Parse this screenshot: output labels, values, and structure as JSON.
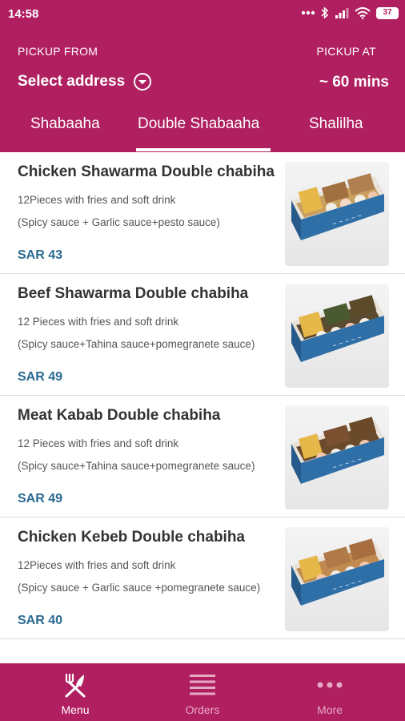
{
  "status_bar": {
    "time": "14:58",
    "battery_level": "37"
  },
  "header": {
    "pickup_from_label": "PICKUP FROM",
    "select_address": "Select address",
    "pickup_at_label": "PICKUP AT",
    "pickup_time": "~ 60 mins"
  },
  "tabs": [
    {
      "label": "Shabaaha",
      "active": false
    },
    {
      "label": "Double Shabaaha",
      "active": true
    },
    {
      "label": "Shalilha",
      "active": false
    }
  ],
  "items": [
    {
      "title": "Chicken Shawarma Double chabiha",
      "desc1": "12Pieces  with  fries  and soft drink",
      "desc2": "(Spicy sauce + Garlic sauce+pesto sauce)",
      "price": "SAR 43"
    },
    {
      "title": "Beef Shawarma Double chabiha",
      "desc1": "12 Pieces  with  fries  and soft drink",
      "desc2": "(Spicy sauce+Tahina sauce+pomegranete sauce)",
      "price": "SAR 49"
    },
    {
      "title": "Meat Kabab Double chabiha",
      "desc1": "12 Pieces with fries  and soft drink",
      "desc2": "(Spicy sauce+Tahina sauce+pomegranete sauce)",
      "price": "SAR 49"
    },
    {
      "title": "Chicken Kebeb  Double chabiha",
      "desc1": "12Pieces  with  fries  and soft drink",
      "desc2": "(Spicy sauce + Garlic sauce +pomegranete sauce)",
      "price": "SAR 40"
    }
  ],
  "bottom_nav": [
    {
      "label": "Menu",
      "icon": "fork-knife-icon",
      "active": true
    },
    {
      "label": "Orders",
      "icon": "list-icon",
      "active": false
    },
    {
      "label": "More",
      "icon": "more-dots-icon",
      "active": false
    }
  ],
  "colors": {
    "brand": "#b01f60",
    "price": "#2a6a93",
    "nav_inactive": "#e6a9c4"
  }
}
